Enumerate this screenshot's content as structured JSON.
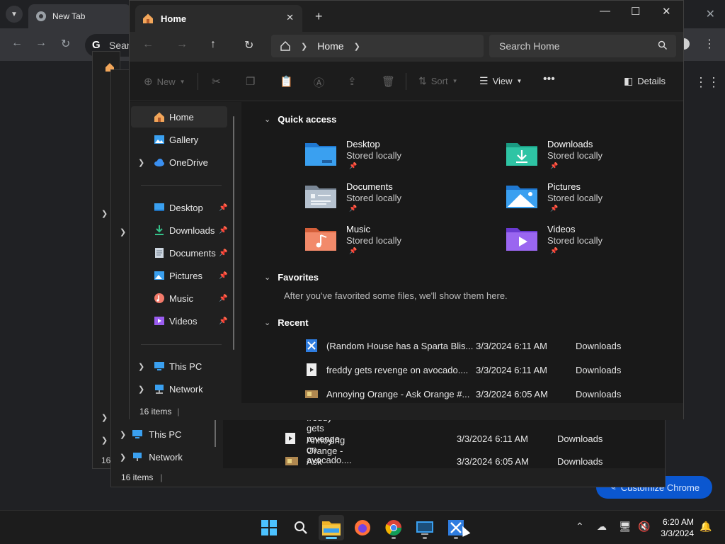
{
  "chrome": {
    "tab_title": "New Tab",
    "omnibox_text": "Sear",
    "customize_label": "Customize Chrome"
  },
  "back_window": {
    "sidebar": [
      {
        "label": "This PC"
      },
      {
        "label": "Network"
      }
    ],
    "recent": [
      {
        "name": "freddy gets revenge on avocado....",
        "date": "3/3/2024 6:11 AM",
        "location": "Downloads"
      },
      {
        "name": "Annoying Orange - Ask Orange #...",
        "date": "3/3/2024 6:05 AM",
        "location": "Downloads"
      }
    ],
    "status": "16 items"
  },
  "explorer": {
    "tab_title": "Home",
    "address": {
      "segment": "Home"
    },
    "search_placeholder": "Search Home",
    "commands": {
      "new": "New",
      "sort": "Sort",
      "view": "View",
      "details": "Details"
    },
    "sidebar": {
      "top": [
        {
          "label": "Home"
        },
        {
          "label": "Gallery"
        },
        {
          "label": "OneDrive"
        }
      ],
      "pinned": [
        {
          "label": "Desktop"
        },
        {
          "label": "Downloads"
        },
        {
          "label": "Documents"
        },
        {
          "label": "Pictures"
        },
        {
          "label": "Music"
        },
        {
          "label": "Videos"
        }
      ],
      "bottom": [
        {
          "label": "This PC"
        },
        {
          "label": "Network"
        }
      ]
    },
    "sections": {
      "quick_access": "Quick access",
      "favorites": "Favorites",
      "recent": "Recent"
    },
    "quick_access": [
      {
        "name": "Desktop",
        "sub": "Stored locally"
      },
      {
        "name": "Downloads",
        "sub": "Stored locally"
      },
      {
        "name": "Documents",
        "sub": "Stored locally"
      },
      {
        "name": "Pictures",
        "sub": "Stored locally"
      },
      {
        "name": "Music",
        "sub": "Stored locally"
      },
      {
        "name": "Videos",
        "sub": "Stored locally"
      }
    ],
    "favorites_message": "After you've favorited some files, we'll show them here.",
    "recent": [
      {
        "name": "(Random House has a Sparta Blis...",
        "date": "3/3/2024 6:11 AM",
        "location": "Downloads"
      },
      {
        "name": "freddy gets revenge on avocado....",
        "date": "3/3/2024 6:11 AM",
        "location": "Downloads"
      },
      {
        "name": "Annoying Orange - Ask Orange #...",
        "date": "3/3/2024 6:05 AM",
        "location": "Downloads"
      }
    ],
    "status": "16 items"
  },
  "taskbar": {
    "time": "6:20 AM",
    "date": "3/3/2024"
  },
  "colors": {
    "accent": "#60cdff",
    "folder_blue": "#3aa0f0",
    "folder_yellow": "#f5c542",
    "chrome_button": "#0b57d0"
  }
}
